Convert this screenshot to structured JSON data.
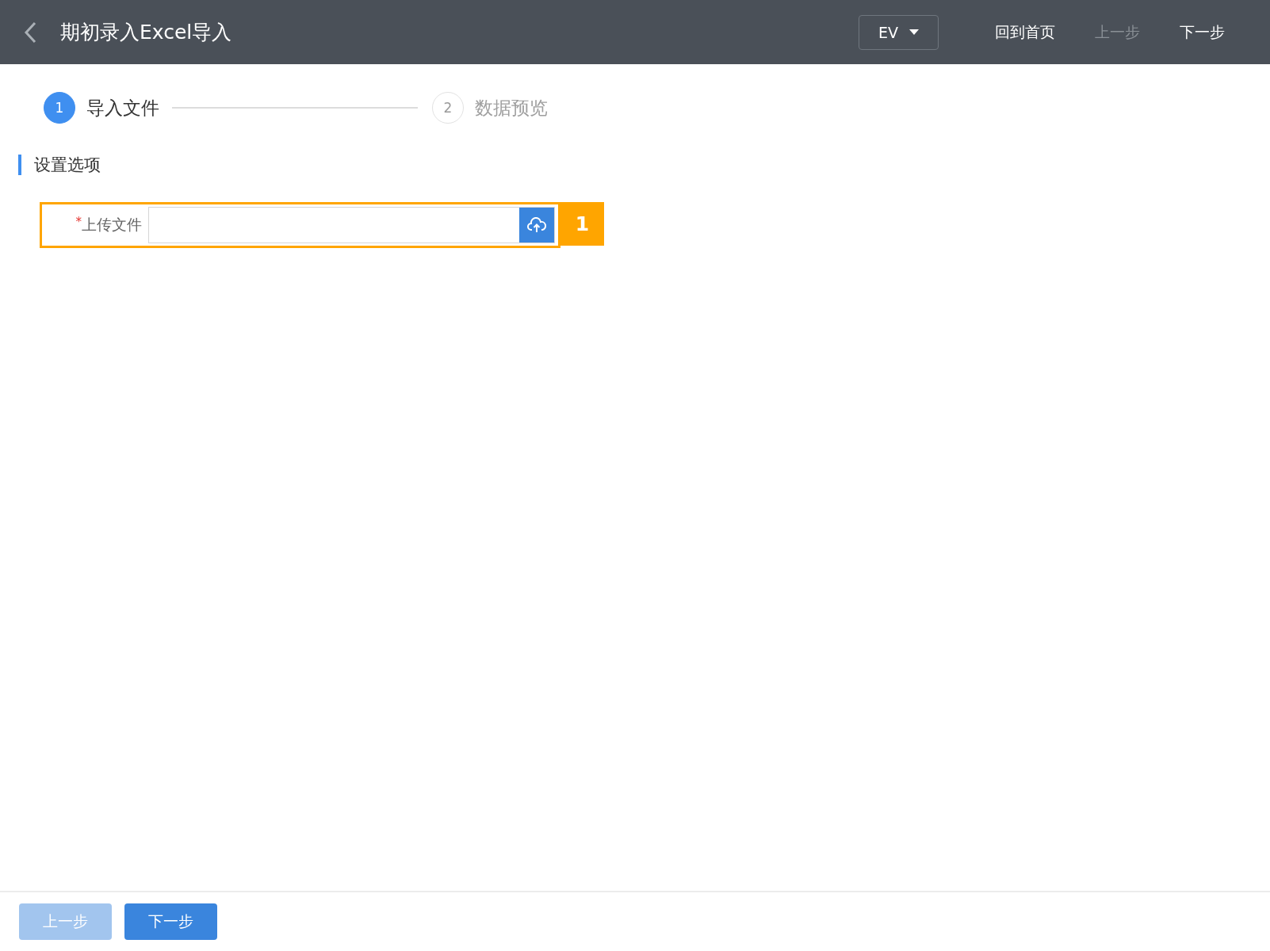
{
  "header": {
    "title": "期初录入Excel导入",
    "dropdown": {
      "value": "EV"
    },
    "actions": [
      {
        "label": "回到首页",
        "disabled": false
      },
      {
        "label": "上一步",
        "disabled": true
      },
      {
        "label": "下一步",
        "disabled": false
      }
    ]
  },
  "steps": [
    {
      "number": "1",
      "label": "导入文件",
      "active": true
    },
    {
      "number": "2",
      "label": "数据预览",
      "active": false
    }
  ],
  "section": {
    "title": "设置选项"
  },
  "form": {
    "required_mark": "*",
    "label": "上传文件",
    "highlighted": true,
    "annotation": "1"
  },
  "footer": {
    "buttons": [
      {
        "label": "上一步",
        "disabled": true
      },
      {
        "label": "下一步",
        "disabled": false
      }
    ]
  }
}
